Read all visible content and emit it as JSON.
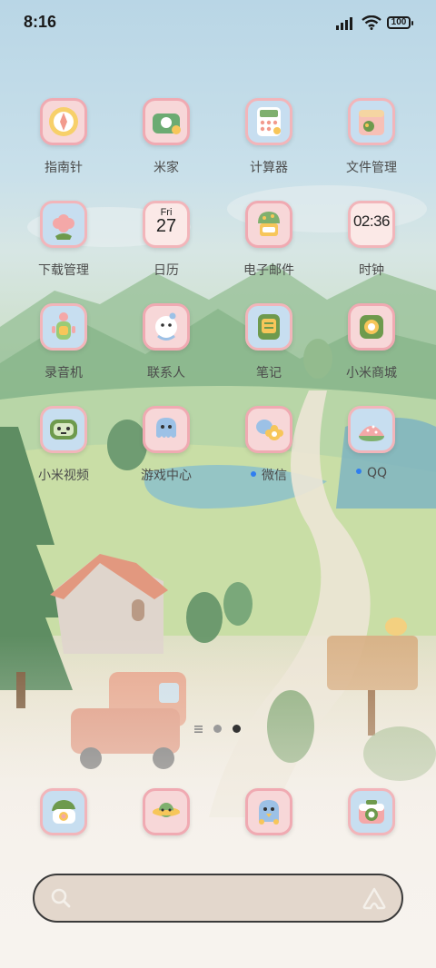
{
  "status_bar": {
    "time": "8:16",
    "battery": "100"
  },
  "apps": [
    {
      "label": "指南针",
      "icon": "compass-icon"
    },
    {
      "label": "米家",
      "icon": "mijia-icon"
    },
    {
      "label": "计算器",
      "icon": "calculator-icon"
    },
    {
      "label": "文件管理",
      "icon": "file-manager-icon"
    },
    {
      "label": "下载管理",
      "icon": "downloads-icon"
    },
    {
      "label": "日历",
      "icon": "calendar-icon",
      "day": "Fri",
      "date": "27"
    },
    {
      "label": "电子邮件",
      "icon": "email-icon"
    },
    {
      "label": "时钟",
      "icon": "clock-icon",
      "time": "02:36"
    },
    {
      "label": "录音机",
      "icon": "recorder-icon"
    },
    {
      "label": "联系人",
      "icon": "contacts-icon"
    },
    {
      "label": "笔记",
      "icon": "notes-icon"
    },
    {
      "label": "小米商城",
      "icon": "mi-store-icon"
    },
    {
      "label": "小米视频",
      "icon": "mi-video-icon"
    },
    {
      "label": "游戏中心",
      "icon": "game-center-icon"
    },
    {
      "label": "微信",
      "icon": "wechat-icon",
      "new_badge": true
    },
    {
      "label": "QQ",
      "icon": "qq-icon",
      "new_badge": true
    }
  ],
  "page_indicator": {
    "pages": 2,
    "current": 2
  },
  "dock": [
    {
      "icon": "phone-icon"
    },
    {
      "icon": "messages-icon"
    },
    {
      "icon": "browser-icon"
    },
    {
      "icon": "camera-icon"
    }
  ],
  "search": {
    "icon": "search-icon",
    "assistant_icon": "assistant-icon"
  },
  "colors": {
    "badge": "#2f7ef0",
    "icon_border": "#f0b3b9",
    "search_bg": "#e3d7cc"
  }
}
